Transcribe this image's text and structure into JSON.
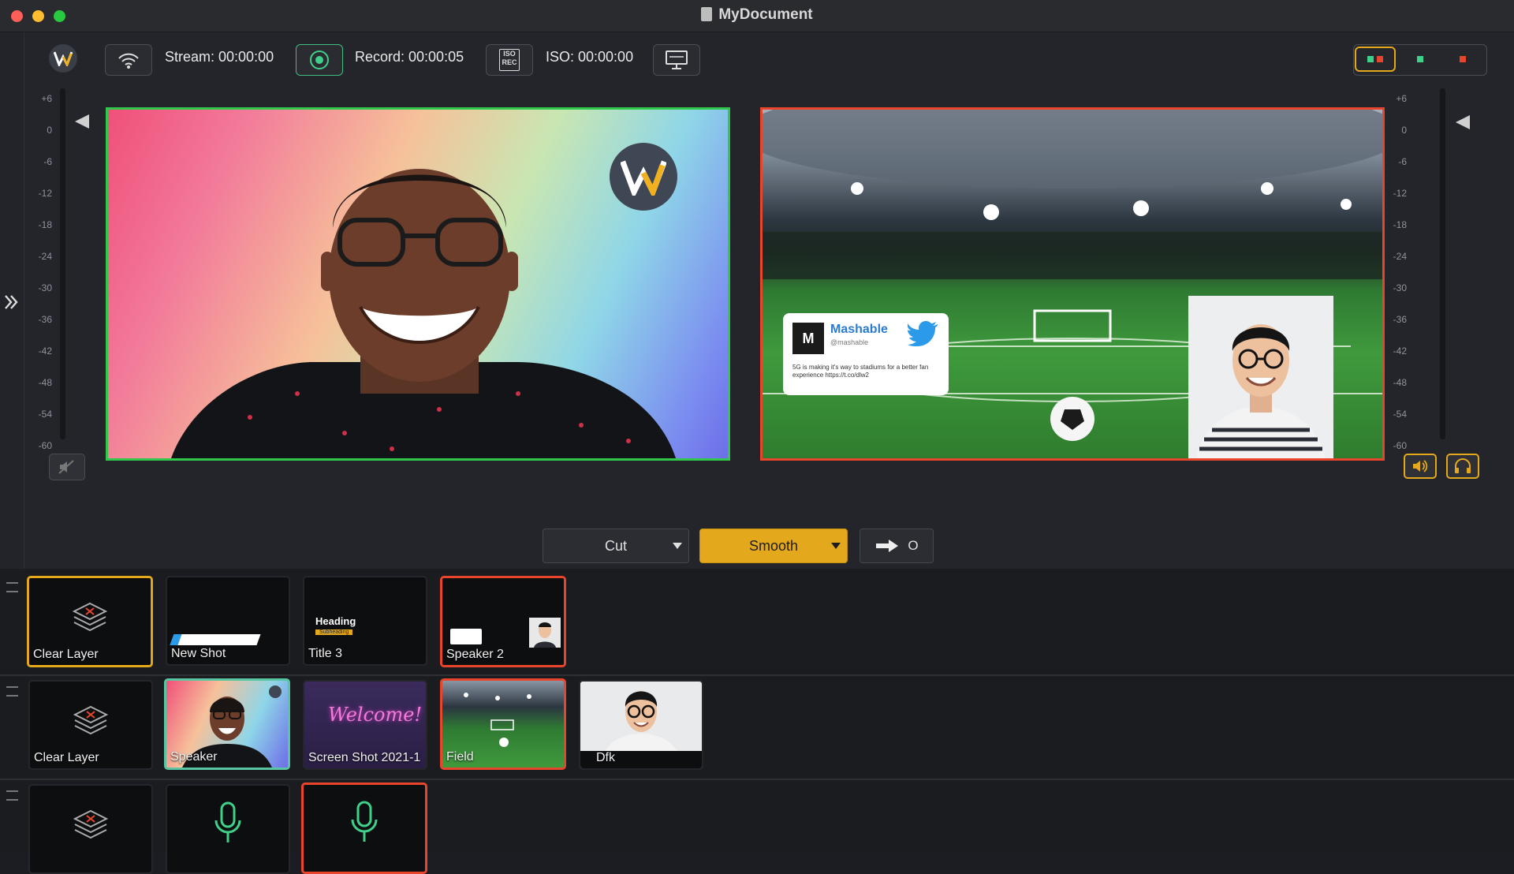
{
  "window": {
    "title": "MyDocument",
    "controls": {
      "close_color": "#ff5f57",
      "minimize_color": "#febc2e",
      "zoom_color": "#28c840"
    }
  },
  "toolbar": {
    "stream_label": "Stream: 00:00:00",
    "record_label": "Record: 00:00:05",
    "iso_label": "ISO: 00:00:00",
    "iso_button_text": "ISO REC",
    "layout_buttons": [
      "live-preview-layout",
      "preview-only-layout",
      "live-only-layout"
    ]
  },
  "audio_meter": {
    "ticks": [
      "+6",
      "0",
      "-6",
      "-12",
      "-18",
      "-24",
      "-30",
      "-36",
      "-42",
      "-48",
      "-54",
      "-60"
    ]
  },
  "preview": {
    "border_color": "#2fc84a"
  },
  "live": {
    "border_color": "#e8452c",
    "tweet_card": {
      "account": "Mashable",
      "handle": "@mashable",
      "text": "5G is making it's way to stadiums for a better fan experience https://t.co/dlw2"
    }
  },
  "transitions": {
    "cut_label": "Cut",
    "smooth_label": "Smooth",
    "go_label": "O"
  },
  "shots": {
    "rows": [
      [
        {
          "label": "Clear Layer",
          "kind": "clear",
          "state": "selected"
        },
        {
          "label": "New Shot",
          "kind": "lower-third",
          "state": "none"
        },
        {
          "label": "Title 3",
          "kind": "title",
          "state": "none",
          "heading": "Heading",
          "subheading": "Subheading"
        },
        {
          "label": "Speaker 2",
          "kind": "speaker2",
          "state": "live"
        }
      ],
      [
        {
          "label": "Clear Layer",
          "kind": "clear",
          "state": "none"
        },
        {
          "label": "Speaker",
          "kind": "speaker",
          "state": "preview"
        },
        {
          "label": "Screen Shot 2021-1",
          "kind": "welcome",
          "state": "none",
          "sign": "Welcome!"
        },
        {
          "label": "Field",
          "kind": "field",
          "state": "live"
        },
        {
          "label": "Dfk",
          "kind": "person",
          "state": "none"
        }
      ],
      [
        {
          "label": "",
          "kind": "clear",
          "state": "none"
        },
        {
          "label": "",
          "kind": "mic",
          "state": "none"
        },
        {
          "label": "",
          "kind": "mic",
          "state": "live"
        }
      ]
    ]
  }
}
